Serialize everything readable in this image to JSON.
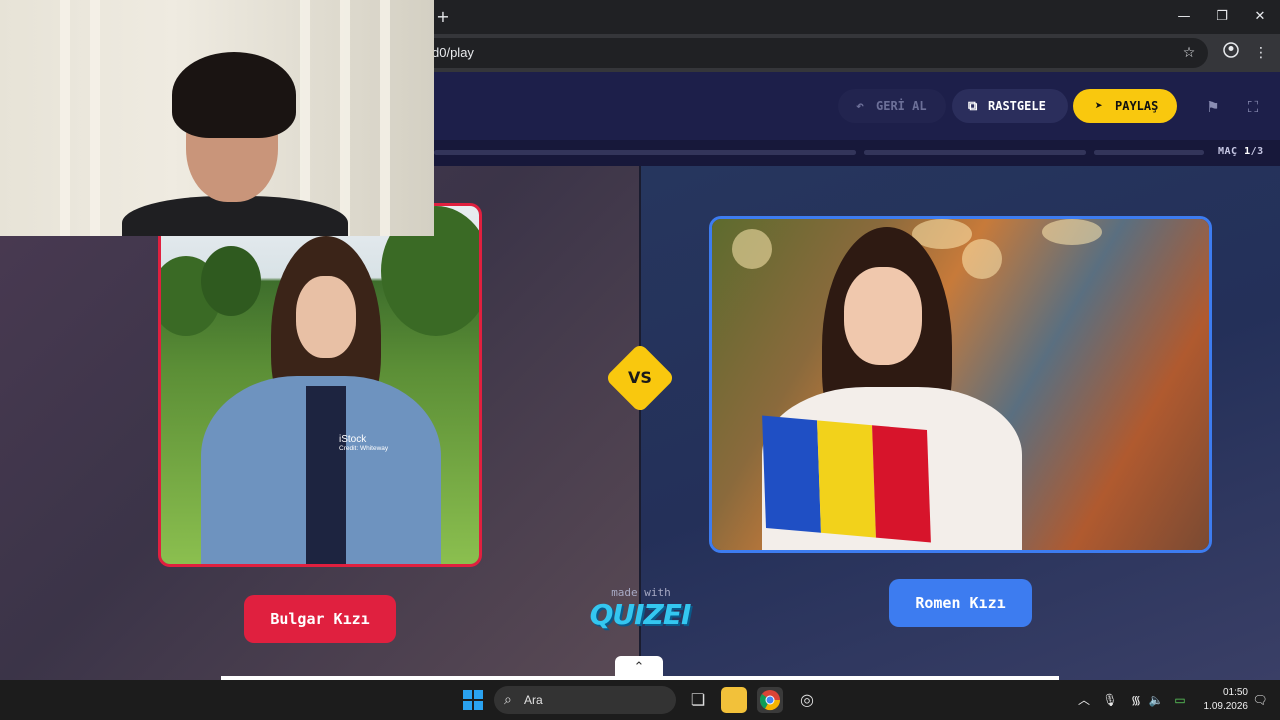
{
  "browser": {
    "new_tab_glyph": "+",
    "url_text": "d0/play",
    "window_controls": {
      "minimize": "—",
      "maximize": "❐",
      "close": "✕"
    }
  },
  "header": {
    "undo_label": "GERİ AL",
    "random_label": "RASTGELE",
    "share_label": "PAYLAŞ",
    "match_prefix": "MAÇ",
    "match_current": "1",
    "match_total": "/3"
  },
  "progress": {
    "segments": 3,
    "current": 1
  },
  "duel": {
    "vs_label": "VS",
    "left": {
      "label": "Bulgar Kızı",
      "watermark": "iStock",
      "watermark_credit": "Credit: Whiteway",
      "accent": "#e0203f"
    },
    "right": {
      "label": "Romen Kızı",
      "accent": "#3d7cf0",
      "flag_colors": [
        "#1f4fc4",
        "#f2d21b",
        "#d7142b"
      ]
    }
  },
  "branding": {
    "made_with": "made with",
    "logo_text": "QUIZEI"
  },
  "expand_glyph": "⌃",
  "taskbar": {
    "search_placeholder": "Ara",
    "time": "01:50",
    "date": "1.09.2026"
  },
  "colors": {
    "yellow": "#f9c80e",
    "header_bg": "#1d1f4a",
    "red": "#e0203f",
    "blue": "#3d7cf0"
  }
}
